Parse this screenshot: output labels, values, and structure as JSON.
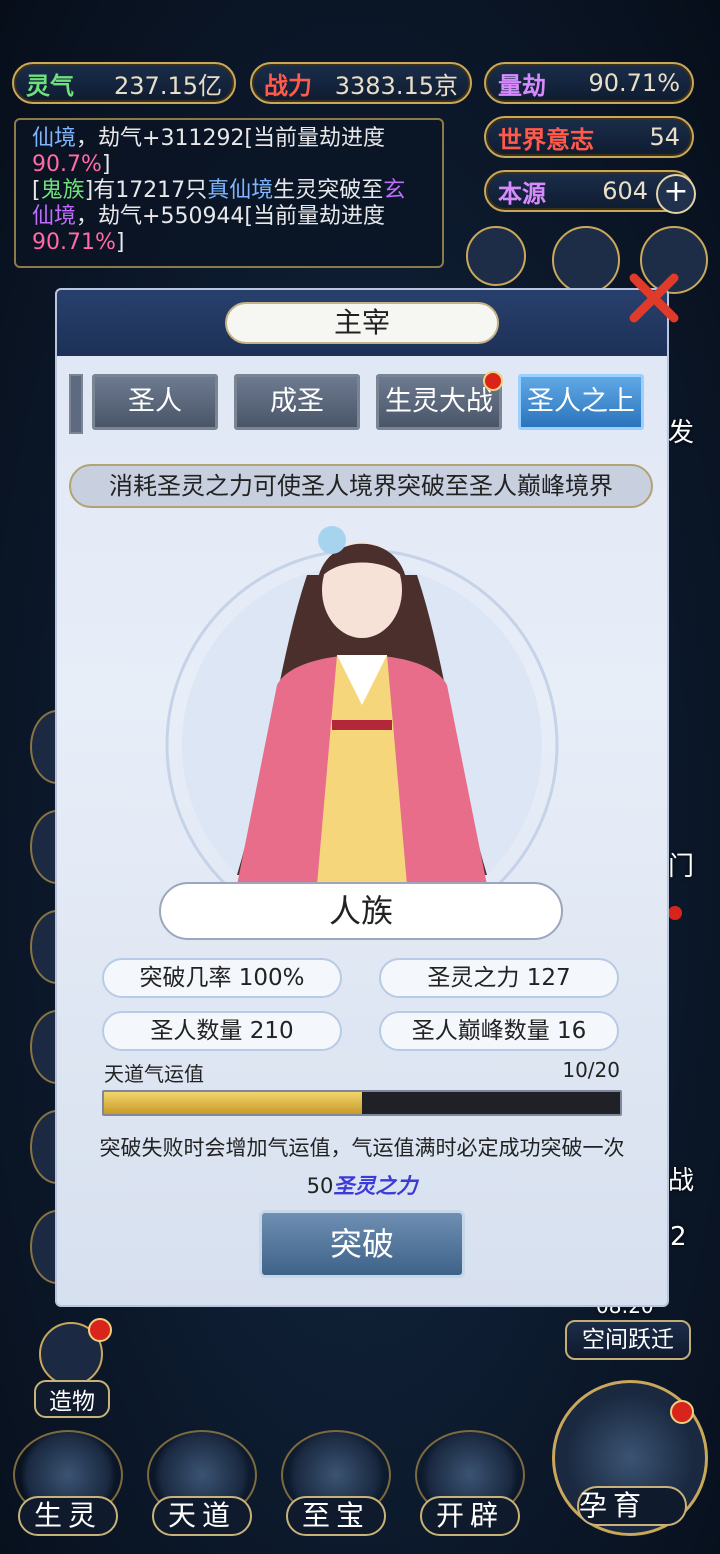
{
  "stats": {
    "lingqi": {
      "label": "灵气",
      "value": "237.15亿"
    },
    "zhanli": {
      "label": "战力",
      "value": "3383.15京"
    },
    "liangjie": {
      "label": "量劫",
      "value": "90.71%"
    },
    "world_will": {
      "label": "世界意志",
      "value": "54"
    },
    "benyuan": {
      "label": "本源",
      "value": "604"
    }
  },
  "log": {
    "line1_a": "仙境",
    "line1_b": "，劫气+311292[当前量劫进度",
    "line2": "90.7%",
    "line2_end": "]",
    "line3_a": "[",
    "line3_race": "鬼族",
    "line3_b": "]有17217只",
    "line3_realm": "真仙境",
    "line3_c": "生灵突破至",
    "line3_target1": "玄",
    "line4_target2": "仙境",
    "line4_b": "，劫气+550944[当前量劫进度",
    "line5": "90.71%",
    "line5_end": "]"
  },
  "dialog": {
    "title": "主宰",
    "tabs": [
      "圣人",
      "成圣",
      "生灵大战",
      "圣人之上"
    ],
    "description": "消耗圣灵之力可使圣人境界突破至圣人巅峰境界",
    "race": "人族",
    "stats": {
      "success_rate": "突破几率 100%",
      "holy_power": "圣灵之力 127",
      "saint_count": "圣人数量 210",
      "peak_count": "圣人巅峰数量 16"
    },
    "fortune_label": "天道气运值",
    "fortune_value": "10/20",
    "fortune_fraction": 0.5,
    "fortune_hint": "突破失败时会增加气运值，气运值满时必定成功突破一次",
    "cost_amount": "50",
    "cost_name": "圣灵之力",
    "break_button": "突破"
  },
  "side": {
    "fa_partial": "发",
    "men_partial": "门",
    "zhan_partial": "战",
    "num_partial": "2",
    "timer_partial": "08:20",
    "space_jump": "空间跃迁",
    "zaowu": "造物"
  },
  "nav": [
    "生灵",
    "天道",
    "至宝",
    "开辟",
    "孕育"
  ]
}
